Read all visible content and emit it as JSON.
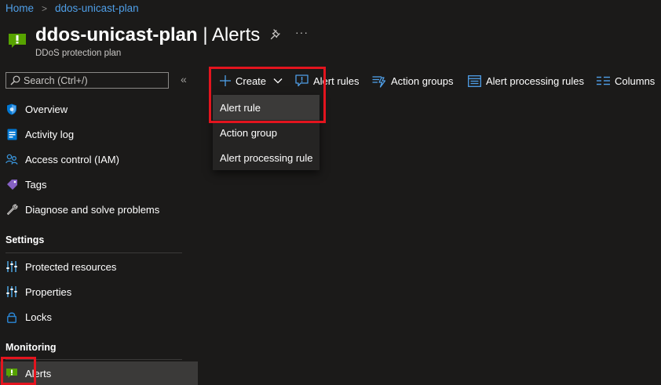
{
  "breadcrumb": {
    "home": "Home",
    "current": "ddos-unicast-plan"
  },
  "header": {
    "title": "ddos-unicast-plan",
    "separator": " | ",
    "section": "Alerts",
    "subtitle": "DDoS protection plan",
    "more": "···"
  },
  "search": {
    "placeholder": "Search (Ctrl+/)",
    "value": "",
    "collapse": "«"
  },
  "sidebar": {
    "items": [
      {
        "label": "Overview",
        "icon": "overview-icon"
      },
      {
        "label": "Activity log",
        "icon": "activity-log-icon"
      },
      {
        "label": "Access control (IAM)",
        "icon": "people-icon"
      },
      {
        "label": "Tags",
        "icon": "tag-icon"
      },
      {
        "label": "Diagnose and solve problems",
        "icon": "wrench-icon"
      }
    ],
    "settings": {
      "heading": "Settings",
      "items": [
        {
          "label": "Protected resources",
          "icon": "sliders-icon"
        },
        {
          "label": "Properties",
          "icon": "sliders-icon"
        },
        {
          "label": "Locks",
          "icon": "lock-icon"
        }
      ]
    },
    "monitoring": {
      "heading": "Monitoring",
      "items": [
        {
          "label": "Alerts",
          "icon": "alert-icon",
          "active": true
        }
      ]
    }
  },
  "toolbar": {
    "create": "Create",
    "alert_rules": "Alert rules",
    "action_groups": "Action groups",
    "alert_processing_rules": "Alert processing rules",
    "columns": "Columns"
  },
  "create_menu": {
    "items": [
      "Alert rule",
      "Action group",
      "Alert processing rule"
    ],
    "highlighted": "Alert rule"
  },
  "colors": {
    "background": "#1b1a19",
    "link": "#4f9fe8",
    "accent_blue": "#0078d4",
    "alert_green": "#57a300",
    "highlight_red": "#e3141e"
  }
}
